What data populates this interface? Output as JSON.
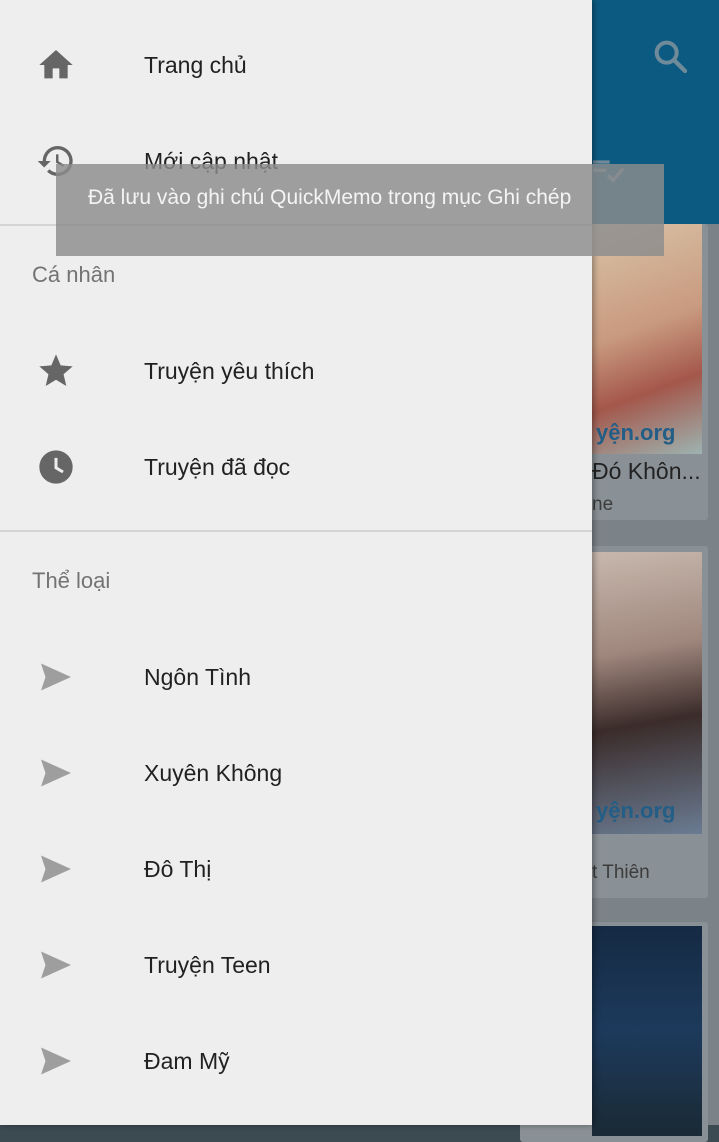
{
  "background": {
    "cards": [
      {
        "title": "Đó Khôn...",
        "author": "ne",
        "cover_text": "yện.org"
      },
      {
        "title": "",
        "author": "t Thiên",
        "cover_text": "yện.org"
      },
      {
        "title": "",
        "author": "",
        "cover_text": ""
      }
    ],
    "toolbar_color": "#0c5a82"
  },
  "drawer": {
    "main_items": [
      {
        "label": "Trang chủ",
        "icon": "home-icon"
      },
      {
        "label": "Mới cập nhật",
        "icon": "history-icon"
      }
    ],
    "personal_header": "Cá nhân",
    "personal_items": [
      {
        "label": "Truyện yêu thích",
        "icon": "star-icon"
      },
      {
        "label": "Truyện đã đọc",
        "icon": "clock-icon"
      }
    ],
    "genre_header": "Thể loại",
    "genre_items": [
      {
        "label": "Ngôn Tình",
        "icon": "send-icon"
      },
      {
        "label": "Xuyên Không",
        "icon": "send-icon"
      },
      {
        "label": "Đô Thị",
        "icon": "send-icon"
      },
      {
        "label": "Truyện Teen",
        "icon": "send-icon"
      },
      {
        "label": "Đam Mỹ",
        "icon": "send-icon"
      }
    ]
  },
  "toast": {
    "message": "Đã lưu vào ghi chú QuickMemo  trong mục Ghi chép"
  }
}
